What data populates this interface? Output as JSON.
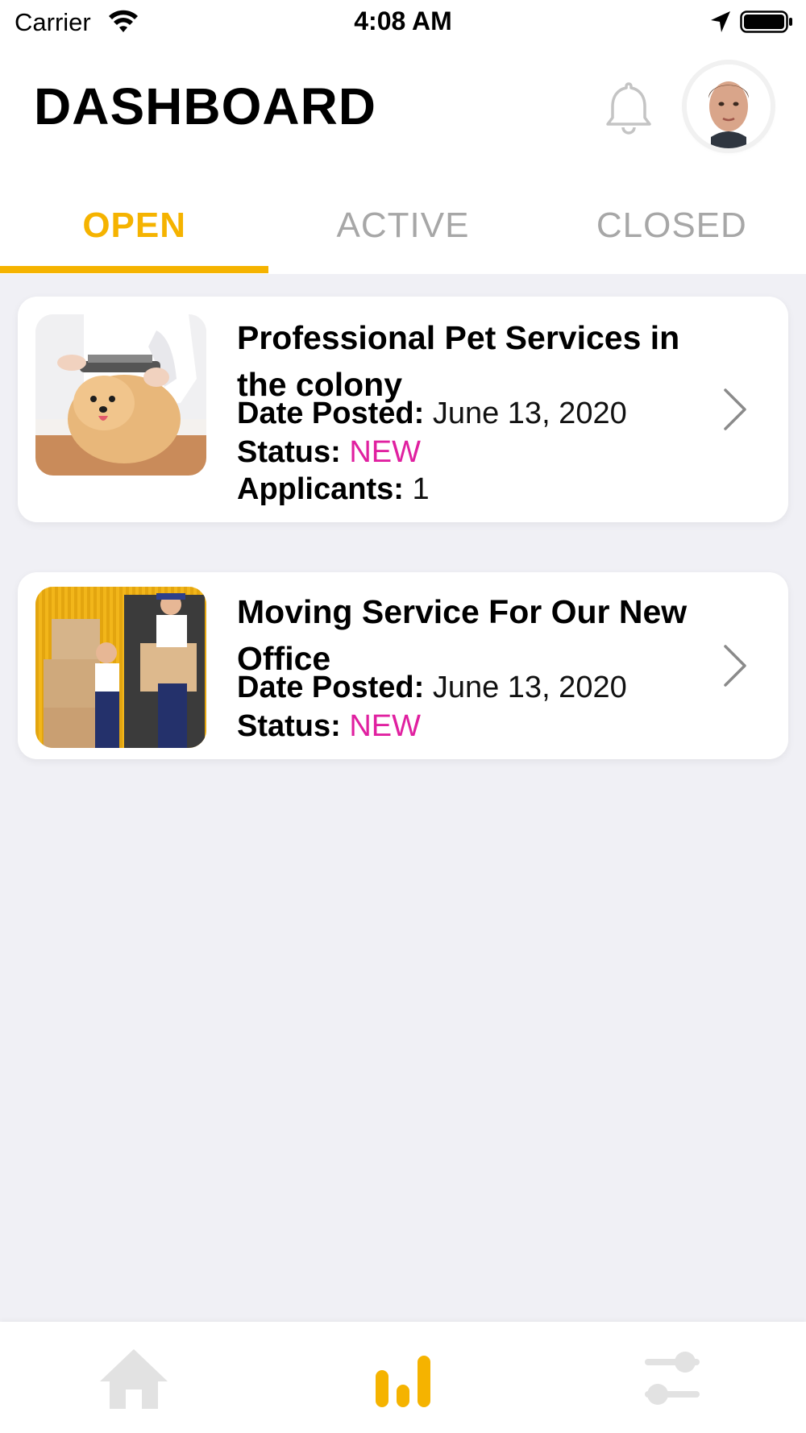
{
  "status_bar": {
    "carrier": "Carrier",
    "time": "4:08 AM"
  },
  "header": {
    "title": "DASHBOARD",
    "icons": [
      "bell-icon",
      "avatar"
    ]
  },
  "tabs": [
    {
      "label": "OPEN",
      "active": true
    },
    {
      "label": "ACTIVE",
      "active": false
    },
    {
      "label": "CLOSED",
      "active": false
    }
  ],
  "colors": {
    "accent": "#f5b300",
    "status_new": "#e020a0",
    "background": "#f0f0f5"
  },
  "jobs": [
    {
      "title": "Professional Pet Services in the colony",
      "date_label": "Date Posted:",
      "date_value": "June 13, 2020",
      "status_label": "Status:",
      "status_value": "NEW",
      "applicants_label": "Applicants:",
      "applicants_value": "1",
      "thumbnail": "dog-grooming-photo"
    },
    {
      "title": "Moving Service For Our New Office",
      "date_label": "Date Posted:",
      "date_value": "June 13, 2020",
      "status_label": "Status:",
      "status_value": "NEW",
      "thumbnail": "movers-photo"
    }
  ],
  "bottom_nav": [
    {
      "icon": "home-icon",
      "active": false
    },
    {
      "icon": "bar-chart-icon",
      "active": true
    },
    {
      "icon": "sliders-icon",
      "active": false
    }
  ]
}
